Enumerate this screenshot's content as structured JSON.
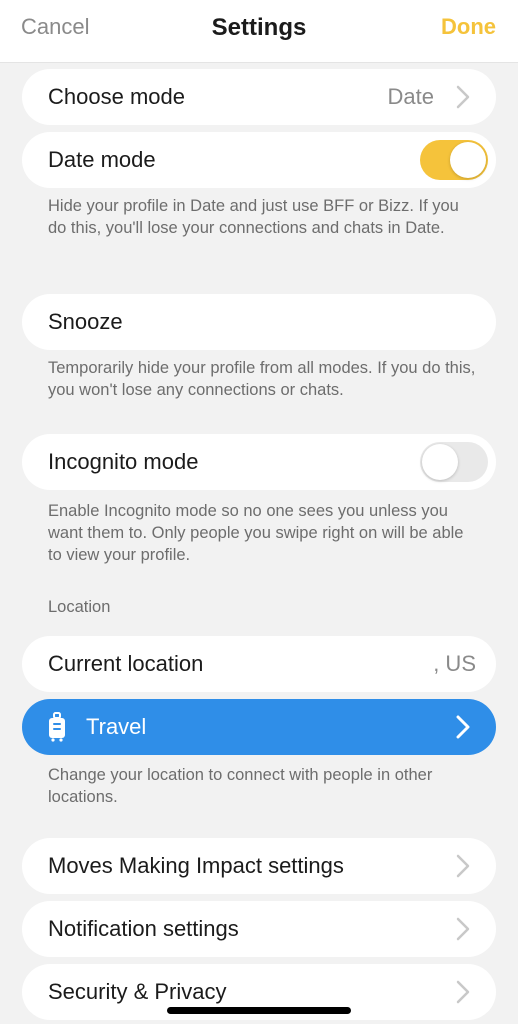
{
  "header": {
    "cancel": "Cancel",
    "title": "Settings",
    "done": "Done"
  },
  "choose_mode": {
    "label": "Choose mode",
    "value": "Date"
  },
  "date_mode": {
    "label": "Date mode",
    "enabled": true,
    "description": "Hide your profile in Date and just use BFF or Bizz. If you do this, you'll lose your connections and chats in Date."
  },
  "snooze": {
    "label": "Snooze",
    "description": "Temporarily hide your profile from all modes. If you do this, you won't lose any connections or chats."
  },
  "incognito": {
    "label": "Incognito mode",
    "enabled": false,
    "description": "Enable Incognito mode so no one sees you unless you want them to. Only people you swipe right on will be able to view your profile."
  },
  "location": {
    "section_title": "Location",
    "current_label": "Current location",
    "current_value": ", US",
    "travel_label": "Travel",
    "travel_icon": "luggage-icon",
    "description": "Change your location to connect with people in other locations."
  },
  "settings_links": {
    "moves": "Moves Making Impact settings",
    "notifications": "Notification settings",
    "security": "Security & Privacy"
  },
  "colors": {
    "accent_yellow": "#f5c33b",
    "travel_blue": "#2f8ee8",
    "background": "#f2f2f2"
  }
}
